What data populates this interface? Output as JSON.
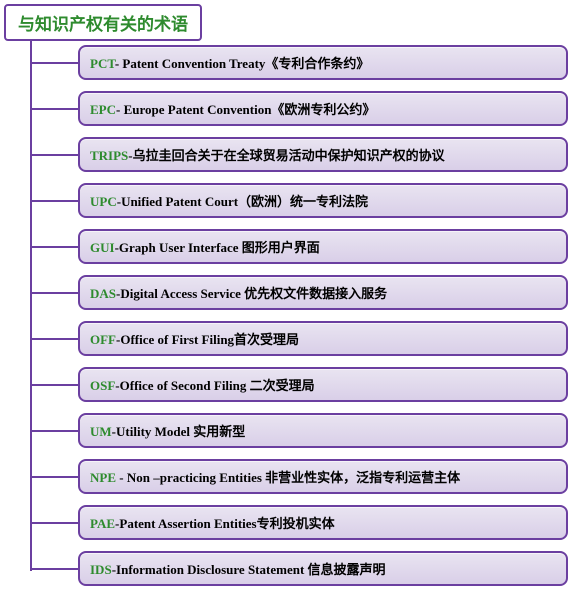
{
  "title": "与知识产权有关的术语",
  "items": [
    {
      "acronym": "PCT",
      "sep": "- ",
      "description": "Patent Convention Treaty《专利合作条约》"
    },
    {
      "acronym": "EPC",
      "sep": "- ",
      "description": "Europe Patent Convention《欧洲专利公约》"
    },
    {
      "acronym": "TRIPS",
      "sep": "-",
      "description": "乌拉圭回合关于在全球贸易活动中保护知识产权的协议"
    },
    {
      "acronym": "UPC",
      "sep": "-",
      "description": "Unified  Patent Court（欧洲）统一专利法院"
    },
    {
      "acronym": "GUI",
      "sep": "-",
      "description": "Graph User Interface 图形用户界面"
    },
    {
      "acronym": "DAS",
      "sep": "-",
      "description": "Digital  Access  Service 优先权文件数据接入服务"
    },
    {
      "acronym": "OFF",
      "sep": "-",
      "description": "Office of First  Filing首次受理局"
    },
    {
      "acronym": "OSF",
      "sep": "-",
      "description": "Office of Second Filing  二次受理局"
    },
    {
      "acronym": "UM",
      "sep": "-",
      "description": "Utility  Model 实用新型"
    },
    {
      "acronym": "NPE ",
      "sep": "- ",
      "description": "Non –practicing Entities 非营业性实体，泛指专利运营主体"
    },
    {
      "acronym": "PAE",
      "sep": "-",
      "description": "Patent Assertion Entities专利投机实体"
    },
    {
      "acronym": "IDS",
      "sep": "-",
      "description": "Information Disclosure  Statement 信息披露声明"
    }
  ]
}
